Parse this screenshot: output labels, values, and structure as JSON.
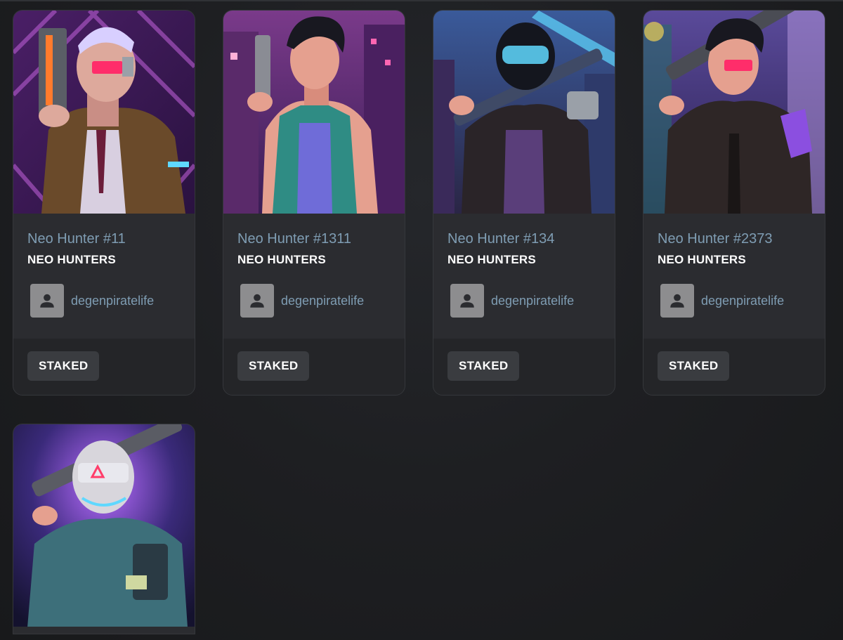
{
  "cards": [
    {
      "name": "Neo Hunter #11",
      "collection": "NEO HUNTERS",
      "owner": "degenpiratelife",
      "status": "STAKED",
      "art_palette": {
        "bg": "#3a1d55",
        "accent": "#b85cd1",
        "glow": "#ff2d6a"
      }
    },
    {
      "name": "Neo Hunter #1311",
      "collection": "NEO HUNTERS",
      "owner": "degenpiratelife",
      "status": "STAKED",
      "art_palette": {
        "bg": "#5a2a6a",
        "accent": "#2f8c84",
        "glow": "#ff66b2"
      }
    },
    {
      "name": "Neo Hunter #134",
      "collection": "NEO HUNTERS",
      "owner": "degenpiratelife",
      "status": "STAKED",
      "art_palette": {
        "bg": "#2a3560",
        "accent": "#3a9bd1",
        "glow": "#5fd8ff"
      }
    },
    {
      "name": "Neo Hunter #2373",
      "collection": "NEO HUNTERS",
      "owner": "degenpiratelife",
      "status": "STAKED",
      "art_palette": {
        "bg": "#3f2f6a",
        "accent": "#8b4fe0",
        "glow": "#ff2d6a"
      }
    },
    {
      "art_palette": {
        "bg": "#22204a",
        "accent": "#3d6f7a",
        "glow": "#b86cff"
      }
    }
  ],
  "colors": {
    "name_text": "#7f9db3",
    "card_bg": "#2b2c30",
    "badge_bg": "#3a3c40"
  }
}
